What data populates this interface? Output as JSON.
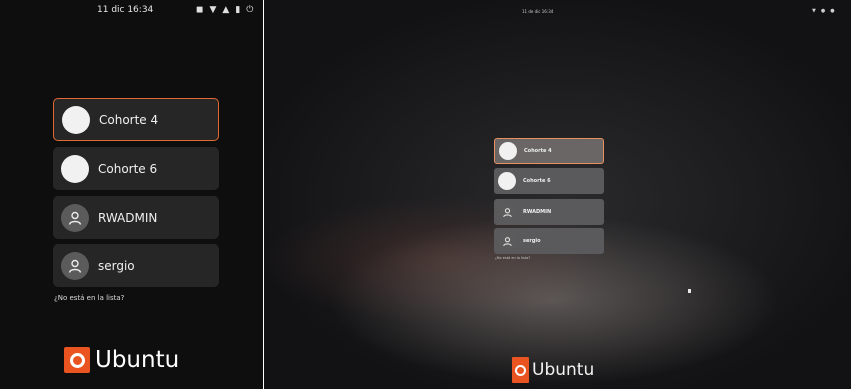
{
  "left_screen": {
    "clock": "11 dic 16:34",
    "status_icons": [
      "speaker-icon",
      "wifi-icon",
      "lock-icon",
      "battery-icon",
      "power-icon"
    ],
    "users": [
      {
        "name": "Cohorte 4",
        "avatar": "white",
        "selected": true
      },
      {
        "name": "Cohorte 6",
        "avatar": "white",
        "selected": false
      },
      {
        "name": "RWADMIN",
        "avatar": "person-icon",
        "selected": false
      },
      {
        "name": "sergio",
        "avatar": "person-icon",
        "selected": false
      }
    ],
    "not_listed": "¿No está en la lista?",
    "brand": "Ubuntu"
  },
  "right_screen": {
    "clock": "11 de dic 16:34",
    "users": [
      {
        "name": "Cohorte 4",
        "avatar": "white",
        "selected": true
      },
      {
        "name": "Cohorte 6",
        "avatar": "white",
        "selected": false
      },
      {
        "name": "RWADMIN",
        "avatar": "person-icon",
        "selected": false
      },
      {
        "name": "sergio",
        "avatar": "person-icon",
        "selected": false
      }
    ],
    "not_listed": "¿No está en la lista?",
    "brand": "Ubuntu"
  },
  "colors": {
    "accent": "#e06a36",
    "ubuntu_orange": "#e95420"
  }
}
